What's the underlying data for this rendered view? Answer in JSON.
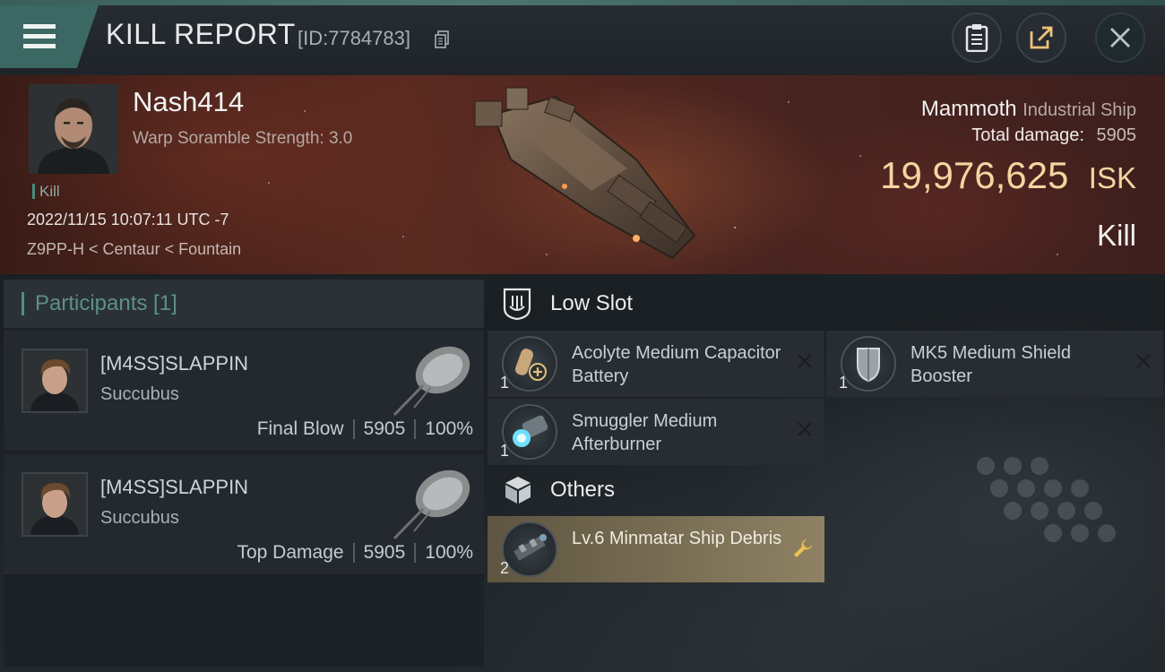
{
  "header": {
    "title": "KILL REPORT",
    "report_id": "[ID:7784783]"
  },
  "victim": {
    "pilot_name": "Nash414",
    "scramble_label": "Warp Soramble Strength: 3.0",
    "kill_tag": "Kill",
    "datetime": "2022/11/15 10:07:11 UTC -7",
    "location": "Z9PP-H < Centaur < Fountain",
    "ship_name": "Mammoth",
    "ship_class": "Industrial Ship",
    "total_damage_label": "Total damage:",
    "total_damage": "5905",
    "isk_value": "19,976,625",
    "isk_unit": "ISK",
    "result": "Kill"
  },
  "participants": {
    "title": "Participants [1]",
    "rows": [
      {
        "name": "[M4SS]SLAPPIN",
        "ship": "Succubus",
        "role": "Final Blow",
        "damage": "5905",
        "percent": "100%"
      },
      {
        "name": "[M4SS]SLAPPIN",
        "ship": "Succubus",
        "role": "Top Damage",
        "damage": "5905",
        "percent": "100%"
      }
    ]
  },
  "low_slot": {
    "title": "Low Slot",
    "items": [
      {
        "name": "Acolyte Medium Capacitor Battery",
        "qty": "1",
        "icon": "capacitor-battery-icon"
      },
      {
        "name": "MK5 Medium Shield Booster",
        "qty": "1",
        "icon": "shield-booster-icon"
      },
      {
        "name": "Smuggler Medium Afterburner",
        "qty": "1",
        "icon": "afterburner-icon"
      }
    ]
  },
  "others": {
    "title": "Others",
    "items": [
      {
        "name": "Lv.6 Minmatar Ship Debris",
        "qty": "2",
        "icon": "ship-debris-icon"
      }
    ]
  },
  "colors": {
    "accent_teal": "#3c6863",
    "isk_gold": "#f3d6a0",
    "highlight_gold": "#8f8264"
  }
}
